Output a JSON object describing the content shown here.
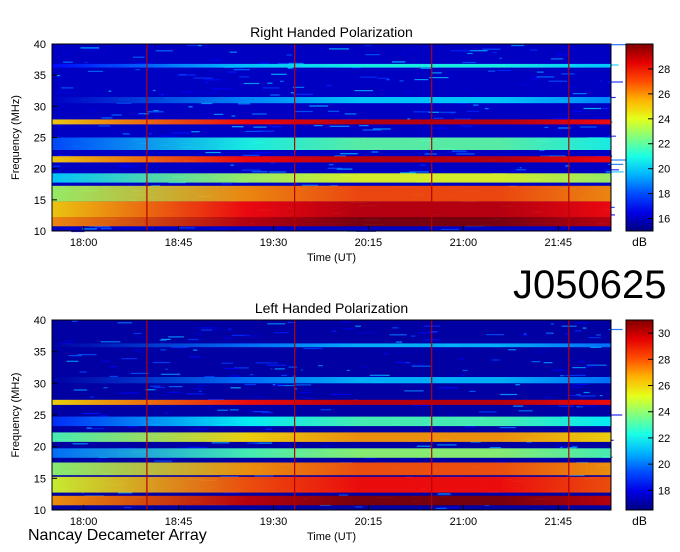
{
  "source_id": "J050625",
  "instrument": "Nancay Decameter Array",
  "chart_data": [
    {
      "type": "heatmap",
      "title": "Right Handed Polarization",
      "xlabel": "Time (UT)",
      "ylabel": "Frequency (MHz)",
      "colorbar_label": "dB",
      "xlim": [
        "17:45",
        "22:10"
      ],
      "ylim": [
        10,
        40
      ],
      "x_ticks": [
        "18:00",
        "18:45",
        "19:30",
        "20:15",
        "21:00",
        "21:45"
      ],
      "y_ticks": [
        10,
        15,
        20,
        25,
        30,
        35,
        40
      ],
      "colorbar_range": [
        15,
        30
      ],
      "colorbar_ticks": [
        16,
        18,
        20,
        22,
        24,
        26,
        28
      ],
      "grid": false,
      "background_level_db": 16,
      "bands": [
        {
          "freq_mhz": 11.5,
          "level_db": 30,
          "width_mhz": 1.5
        },
        {
          "freq_mhz": 13.5,
          "level_db": 29,
          "width_mhz": 2.5
        },
        {
          "freq_mhz": 16.0,
          "level_db": 27,
          "width_mhz": 2.5
        },
        {
          "freq_mhz": 18.5,
          "level_db": 24,
          "width_mhz": 1.5
        },
        {
          "freq_mhz": 21.5,
          "level_db": 29,
          "width_mhz": 1.0
        },
        {
          "freq_mhz": 24.0,
          "level_db": 22,
          "width_mhz": 2.0
        },
        {
          "freq_mhz": 27.5,
          "level_db": 29,
          "width_mhz": 0.8
        },
        {
          "freq_mhz": 31.0,
          "level_db": 20,
          "width_mhz": 1.0
        },
        {
          "freq_mhz": 36.5,
          "level_db": 21,
          "width_mhz": 0.6
        }
      ]
    },
    {
      "type": "heatmap",
      "title": "Left Handed Polarization",
      "xlabel": "Time (UT)",
      "ylabel": "Frequency (MHz)",
      "colorbar_label": "dB",
      "xlim": [
        "17:45",
        "22:10"
      ],
      "ylim": [
        10,
        40
      ],
      "x_ticks": [
        "18:00",
        "18:45",
        "19:30",
        "20:15",
        "21:00",
        "21:45"
      ],
      "y_ticks": [
        10,
        15,
        20,
        25,
        30,
        35,
        40
      ],
      "colorbar_range": [
        16.5,
        31
      ],
      "colorbar_ticks": [
        18,
        20,
        22,
        24,
        26,
        28,
        30
      ],
      "grid": false,
      "background_level_db": 17,
      "bands": [
        {
          "freq_mhz": 11.5,
          "level_db": 31,
          "width_mhz": 1.5
        },
        {
          "freq_mhz": 14.0,
          "level_db": 29,
          "width_mhz": 2.5
        },
        {
          "freq_mhz": 16.5,
          "level_db": 28,
          "width_mhz": 2.0
        },
        {
          "freq_mhz": 19.0,
          "level_db": 24,
          "width_mhz": 1.5
        },
        {
          "freq_mhz": 21.5,
          "level_db": 27,
          "width_mhz": 1.5
        },
        {
          "freq_mhz": 24.0,
          "level_db": 23,
          "width_mhz": 1.5
        },
        {
          "freq_mhz": 27.0,
          "level_db": 30,
          "width_mhz": 0.8
        },
        {
          "freq_mhz": 30.5,
          "level_db": 21,
          "width_mhz": 1.0
        },
        {
          "freq_mhz": 36.0,
          "level_db": 21,
          "width_mhz": 0.6
        }
      ]
    }
  ]
}
